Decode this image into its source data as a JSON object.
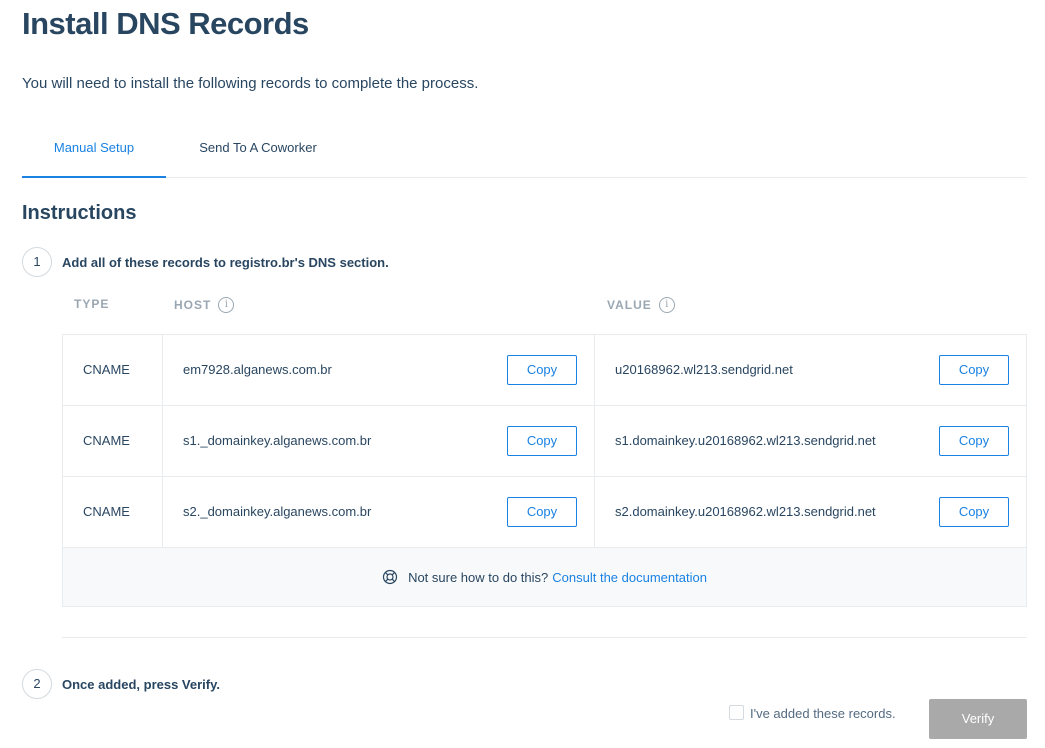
{
  "page": {
    "title": "Install DNS Records",
    "intro": "You will need to install the following records to complete the process."
  },
  "tabs": [
    {
      "label": "Manual Setup",
      "active": true
    },
    {
      "label": "Send To A Coworker",
      "active": false
    }
  ],
  "instructions": {
    "title": "Instructions",
    "step1": {
      "number": "1",
      "text": "Add all of these records to registro.br's DNS section."
    },
    "step2": {
      "number": "2",
      "text": "Once added, press Verify."
    }
  },
  "table": {
    "headers": {
      "type": "TYPE",
      "host": "HOST",
      "value": "VALUE"
    },
    "info_icon_glyph": "i",
    "copy_label": "Copy",
    "rows": [
      {
        "type": "CNAME",
        "host": "em7928.alganews.com.br",
        "value": "u20168962.wl213.sendgrid.net"
      },
      {
        "type": "CNAME",
        "host": "s1._domainkey.alganews.com.br",
        "value": "s1.domainkey.u20168962.wl213.sendgrid.net"
      },
      {
        "type": "CNAME",
        "host": "s2._domainkey.alganews.com.br",
        "value": "s2.domainkey.u20168962.wl213.sendgrid.net"
      }
    ]
  },
  "help": {
    "icon": "lifebuoy-icon",
    "text": "Not sure how to do this?",
    "link": "Consult the documentation"
  },
  "confirm": {
    "checkbox_label": "I've added these records.",
    "checked": false,
    "verify_label": "Verify"
  },
  "colors": {
    "accent": "#1a82e2",
    "text": "#294661",
    "muted": "#9aa7b2",
    "disabled_button": "#a9a9a9"
  }
}
